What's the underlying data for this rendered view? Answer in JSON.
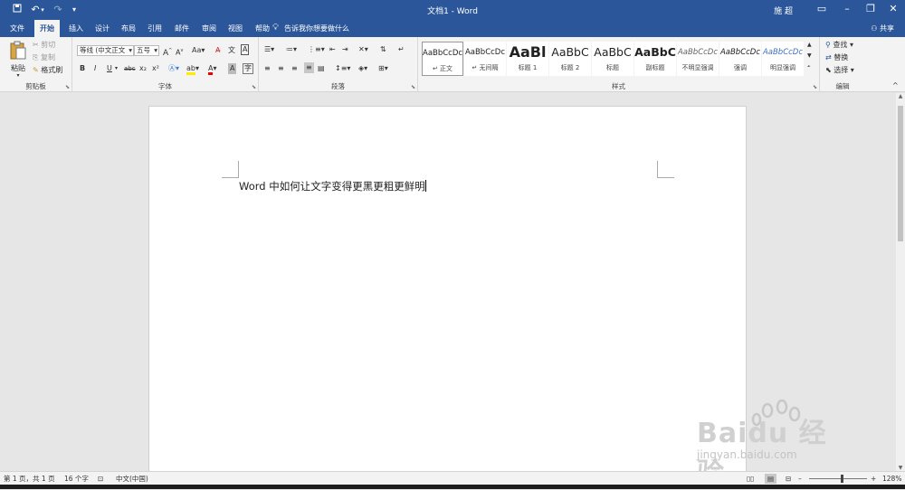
{
  "titlebar": {
    "doc_title": "文档1 - Word",
    "user_name": "施 超",
    "quick_access": {
      "save": "save-icon",
      "undo": "undo-icon",
      "redo": "redo-icon"
    }
  },
  "tabs": [
    {
      "label": "文件"
    },
    {
      "label": "开始"
    },
    {
      "label": "插入"
    },
    {
      "label": "设计"
    },
    {
      "label": "布局"
    },
    {
      "label": "引用"
    },
    {
      "label": "邮件"
    },
    {
      "label": "审阅"
    },
    {
      "label": "视图"
    },
    {
      "label": "帮助"
    }
  ],
  "tell_me": "告诉我你想要做什么",
  "share": "共享",
  "clipboard": {
    "label": "剪贴板",
    "paste": "粘贴",
    "cut": "剪切",
    "copy": "复制",
    "format_painter": "格式刷"
  },
  "font": {
    "label": "字体",
    "font_name": "等线 (中文正文",
    "font_size": "五号",
    "bold": "B",
    "italic": "I",
    "underline": "U",
    "strike": "abc",
    "subscript": "x₂",
    "superscript": "x²",
    "grow": "A",
    "shrink": "A",
    "case": "Aa",
    "font_color": "A",
    "shading": "A",
    "wen": "文",
    "border_char": "A"
  },
  "paragraph": {
    "label": "段落"
  },
  "styles": {
    "label": "样式",
    "items": [
      {
        "sample": "AaBbCcDc",
        "name": "正文"
      },
      {
        "sample": "AaBbCcDc",
        "name": "无间隔"
      },
      {
        "sample": "AaBl",
        "name": "标题 1"
      },
      {
        "sample": "AaBbC",
        "name": "标题 2"
      },
      {
        "sample": "AaBbC",
        "name": "标题"
      },
      {
        "sample": "AaBbC",
        "name": "副标题"
      },
      {
        "sample": "AaBbCcDc",
        "name": "不明显强调"
      },
      {
        "sample": "AaBbCcDc",
        "name": "强调"
      },
      {
        "sample": "AaBbCcDc",
        "name": "明显强调"
      }
    ]
  },
  "editing": {
    "label": "编辑",
    "find": "查找",
    "replace": "替换",
    "select": "选择"
  },
  "document": {
    "text": "Word 中如何让文字变得更黑更粗更鲜明"
  },
  "status": {
    "page": "第 1 页，共 1 页",
    "words": "16 个字",
    "language": "中文(中国)",
    "zoom": "128%"
  },
  "watermark": {
    "brand": "Baidu 经验",
    "url": "jingyan.baidu.com"
  },
  "colors": {
    "accent": "#2b579a",
    "ribbon": "#f3f3f3",
    "canvas": "#e6e6e6"
  }
}
